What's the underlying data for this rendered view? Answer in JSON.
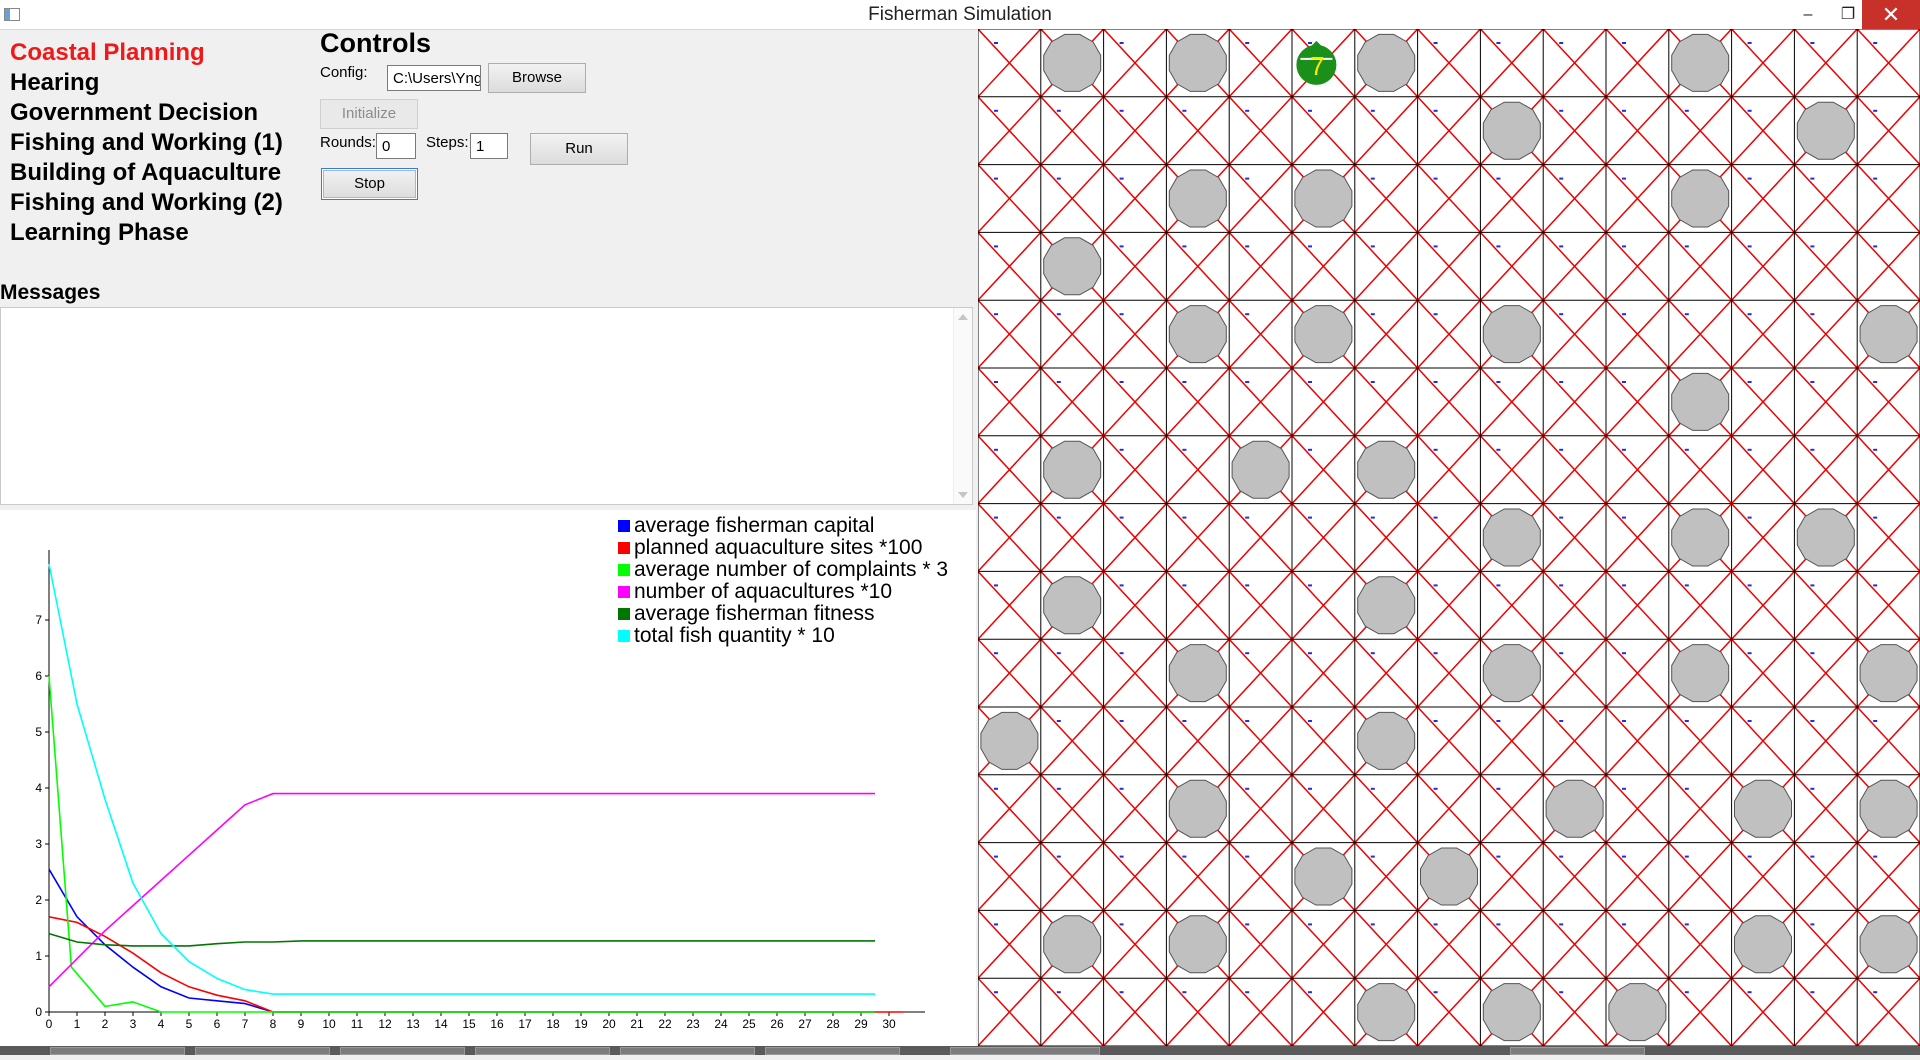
{
  "window": {
    "title": "Fisherman Simulation",
    "minimize": "–",
    "maximize": "❐",
    "close": "✕"
  },
  "phases": [
    {
      "label": "Coastal Planning",
      "active": true
    },
    {
      "label": "Hearing",
      "active": false
    },
    {
      "label": "Government Decision",
      "active": false
    },
    {
      "label": "Fishing and Working (1)",
      "active": false
    },
    {
      "label": "Building of Aquaculture",
      "active": false
    },
    {
      "label": "Fishing and Working (2)",
      "active": false
    },
    {
      "label": "Learning Phase",
      "active": false
    }
  ],
  "controls": {
    "title": "Controls",
    "config_label": "Config:",
    "config_value": "C:\\Users\\Yng",
    "browse_label": "Browse",
    "initialize_label": "Initialize",
    "rounds_label": "Rounds:",
    "rounds_value": "0",
    "steps_label": "Steps:",
    "steps_value": "1",
    "run_label": "Run",
    "stop_label": "Stop"
  },
  "messages": {
    "title": "Messages",
    "content": ""
  },
  "chart_data": {
    "type": "line",
    "title": "",
    "xlabel": "",
    "ylabel": "",
    "xlim": [
      0,
      30
    ],
    "ylim": [
      0,
      8
    ],
    "x_ticks": [
      0,
      1,
      2,
      3,
      4,
      5,
      6,
      7,
      8,
      9,
      10,
      11,
      12,
      13,
      14,
      15,
      16,
      17,
      18,
      19,
      20,
      21,
      22,
      23,
      24,
      25,
      26,
      27,
      28,
      29,
      30
    ],
    "y_ticks": [
      0,
      1,
      2,
      3,
      4,
      5,
      6,
      7
    ],
    "legend_position": "top-right",
    "series": [
      {
        "name": "average fisherman capital",
        "color": "#0000ff",
        "points": [
          [
            0,
            2.55
          ],
          [
            1,
            1.7
          ],
          [
            2,
            1.2
          ],
          [
            3,
            0.8
          ],
          [
            4,
            0.45
          ],
          [
            5,
            0.25
          ],
          [
            6,
            0.2
          ],
          [
            7,
            0.15
          ],
          [
            8,
            0
          ],
          [
            29.5,
            0
          ]
        ]
      },
      {
        "name": "planned aquaculture sites *100",
        "color": "#ff0000",
        "points": [
          [
            0,
            1.7
          ],
          [
            1,
            1.6
          ],
          [
            2,
            1.35
          ],
          [
            3,
            1.05
          ],
          [
            4,
            0.7
          ],
          [
            5,
            0.45
          ],
          [
            6,
            0.3
          ],
          [
            7,
            0.2
          ],
          [
            8,
            0
          ],
          [
            30.5,
            0
          ]
        ]
      },
      {
        "name": "average number of complaints * 3",
        "color": "#00ff00",
        "points": [
          [
            0,
            6.0
          ],
          [
            0.8,
            0.8
          ],
          [
            2,
            0.1
          ],
          [
            3,
            0.18
          ],
          [
            4,
            0
          ],
          [
            29.5,
            0
          ]
        ]
      },
      {
        "name": "number of aquacultures *10",
        "color": "#ff00ff",
        "points": [
          [
            0,
            0.45
          ],
          [
            1,
            0.95
          ],
          [
            2,
            1.45
          ],
          [
            3,
            1.9
          ],
          [
            4,
            2.35
          ],
          [
            5,
            2.8
          ],
          [
            6,
            3.25
          ],
          [
            7,
            3.7
          ],
          [
            8,
            3.9
          ],
          [
            29.5,
            3.9
          ]
        ]
      },
      {
        "name": "average fisherman fitness",
        "color": "#007700",
        "points": [
          [
            0,
            1.4
          ],
          [
            1,
            1.25
          ],
          [
            2,
            1.2
          ],
          [
            3,
            1.18
          ],
          [
            4,
            1.18
          ],
          [
            5,
            1.18
          ],
          [
            6,
            1.22
          ],
          [
            7,
            1.25
          ],
          [
            8,
            1.25
          ],
          [
            9,
            1.27
          ],
          [
            29.5,
            1.27
          ]
        ]
      },
      {
        "name": "total fish quantity * 10",
        "color": "#00ffff",
        "points": [
          [
            0,
            8.0
          ],
          [
            1,
            5.5
          ],
          [
            2,
            3.8
          ],
          [
            3,
            2.3
          ],
          [
            4,
            1.4
          ],
          [
            5,
            0.9
          ],
          [
            6,
            0.6
          ],
          [
            7,
            0.4
          ],
          [
            8,
            0.32
          ],
          [
            29.5,
            0.32
          ]
        ]
      }
    ]
  },
  "grid": {
    "rows": 15,
    "cols": 15,
    "cross_color": "#ee0000",
    "line_color": "#000000",
    "rock_color": "#c0c0c0",
    "rocks": [
      [
        0,
        1
      ],
      [
        0,
        3
      ],
      [
        0,
        6
      ],
      [
        0,
        11
      ],
      [
        1,
        8
      ],
      [
        1,
        13
      ],
      [
        2,
        3
      ],
      [
        2,
        5
      ],
      [
        2,
        11
      ],
      [
        3,
        1
      ],
      [
        4,
        3
      ],
      [
        4,
        5
      ],
      [
        4,
        8
      ],
      [
        4,
        14
      ],
      [
        5,
        11
      ],
      [
        6,
        1
      ],
      [
        6,
        4
      ],
      [
        6,
        6
      ],
      [
        7,
        8
      ],
      [
        7,
        11
      ],
      [
        7,
        13
      ],
      [
        8,
        1
      ],
      [
        8,
        6
      ],
      [
        9,
        3
      ],
      [
        9,
        8
      ],
      [
        9,
        11
      ],
      [
        9,
        14
      ],
      [
        10,
        0
      ],
      [
        10,
        6
      ],
      [
        11,
        3
      ],
      [
        11,
        9
      ],
      [
        11,
        12
      ],
      [
        11,
        14
      ],
      [
        12,
        5
      ],
      [
        12,
        7
      ],
      [
        13,
        1
      ],
      [
        13,
        3
      ],
      [
        13,
        12
      ],
      [
        13,
        14
      ],
      [
        14,
        6
      ],
      [
        14,
        8
      ],
      [
        14,
        10
      ]
    ],
    "fisherman": {
      "row": 0,
      "col": 5,
      "label": "7",
      "color": "#1a8f1a"
    }
  }
}
